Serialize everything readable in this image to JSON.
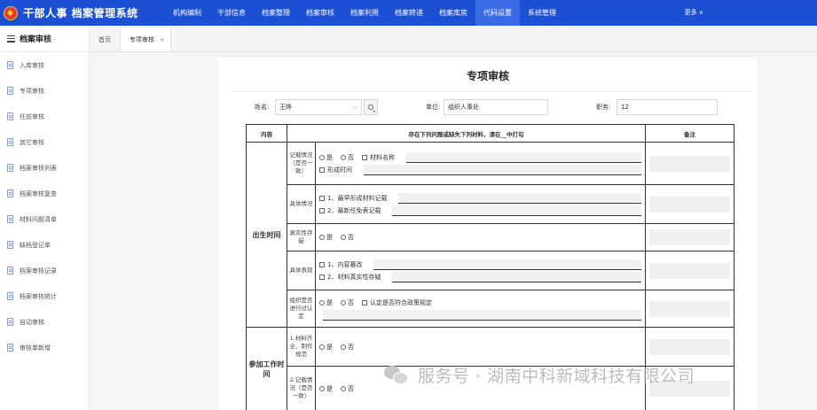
{
  "app": {
    "logo_text": "干部人事 档案管理系统"
  },
  "nav": {
    "items": [
      "机构编制",
      "干部信息",
      "档案整理",
      "档案审核",
      "档案利用",
      "档案转递",
      "档案库房",
      "代码设置",
      "系统管理"
    ],
    "active_index": 7,
    "more": "更多 ∧"
  },
  "sidebar": {
    "title": "档案审核",
    "items": [
      "入库审核",
      "专项审核",
      "任前审核",
      "其它审核",
      "档案审核列表",
      "档案审核复查",
      "材料问题清单",
      "缺档登记单",
      "档案审核记录",
      "档案审核统计",
      "自动审核",
      "审核单新增"
    ]
  },
  "tabs": [
    {
      "label": "首页"
    },
    {
      "label": "专项审核",
      "close": "×"
    }
  ],
  "page": {
    "title": "专项审核"
  },
  "form": {
    "name_label": "姓名:",
    "name_value": "王晔",
    "unit_label": "单位:",
    "unit_value": "组织人事处",
    "position_label": "职务:",
    "position_value": "12"
  },
  "table": {
    "headers": [
      "内容",
      "存在下列问题或缺失下列材料，请在__中打勾",
      "备注"
    ],
    "groups": [
      {
        "label": "出生时间",
        "rows": [
          {
            "label": "记载情况（是否一致）",
            "lines": [
              [
                {
                  "kind": "radio",
                  "text": "是"
                },
                {
                  "kind": "radio",
                  "text": "否"
                },
                {
                  "kind": "check",
                  "text": "材料名称"
                },
                {
                  "kind": "fill"
                }
              ],
              [
                {
                  "kind": "check",
                  "text": "形成时间"
                },
                {
                  "kind": "fill"
                }
              ]
            ]
          },
          {
            "label": "具体情况",
            "lines": [
              [
                {
                  "kind": "check",
                  "text": "1、最早形成材料记载"
                },
                {
                  "kind": "fill"
                }
              ],
              [
                {
                  "kind": "check",
                  "text": "2、最新任免表记载"
                },
                {
                  "kind": "fill"
                }
              ]
            ]
          },
          {
            "label": "真实性存疑",
            "lines": [
              [
                {
                  "kind": "radio",
                  "text": "是"
                },
                {
                  "kind": "radio",
                  "text": "否"
                }
              ]
            ]
          },
          {
            "label": "具体表现",
            "lines": [
              [
                {
                  "kind": "check",
                  "text": "1、内容篡改"
                },
                {
                  "kind": "fill"
                }
              ],
              [
                {
                  "kind": "check",
                  "text": "2、材料真实性存疑"
                },
                {
                  "kind": "fill"
                }
              ]
            ]
          },
          {
            "label": "组织是否进行过认定",
            "lines": [
              [
                {
                  "kind": "radio",
                  "text": "是"
                },
                {
                  "kind": "radio",
                  "text": "否"
                },
                {
                  "kind": "check",
                  "text": "认定是否符合政策规定"
                }
              ],
              [
                {
                  "kind": "fill"
                }
              ]
            ]
          }
        ]
      },
      {
        "label": "参加工作时间",
        "rows": [
          {
            "label": "1.材料齐全、制作规范",
            "lines": [
              [
                {
                  "kind": "radio",
                  "text": "是"
                },
                {
                  "kind": "radio",
                  "text": "否"
                }
              ]
            ]
          },
          {
            "label": "2.记载情况（是否一致）",
            "lines": [
              [
                {
                  "kind": "radio",
                  "text": "是"
                },
                {
                  "kind": "radio",
                  "text": "否"
                }
              ]
            ]
          }
        ]
      }
    ]
  },
  "watermark": {
    "text": "服务号 · 湖南中科新域科技有限公司"
  }
}
